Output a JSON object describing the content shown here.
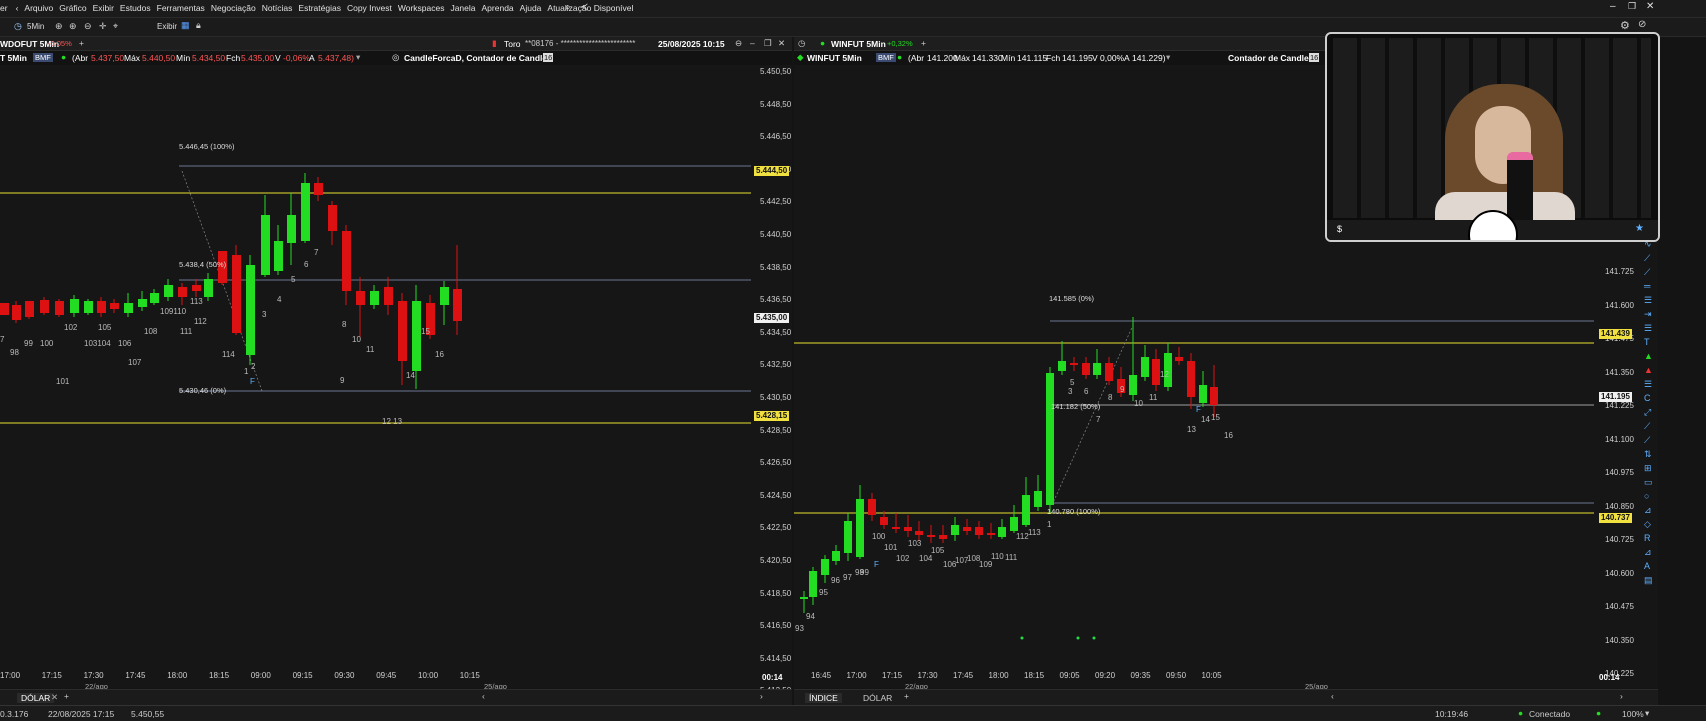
{
  "menu": {
    "items": [
      "er",
      "Arquivo",
      "Gráfico",
      "Exibir",
      "Estudos",
      "Ferramentas",
      "Negociação",
      "Notícias",
      "Estratégias",
      "Copy Invest",
      "Workspaces",
      "Janela",
      "Aprenda",
      "Ajuda",
      "Atualização Disponível"
    ]
  },
  "toolbar": {
    "interval": "5Min",
    "view_label": "Exibir"
  },
  "left_chart": {
    "tab_title": "WDOFUT 5Min",
    "tab_change": "-0,05%",
    "center_title": "Toro",
    "account": "**08176 - ************************",
    "datetime": "25/08/2025 10:15",
    "symbol": "T 5Min",
    "exchange": "BMF",
    "abr_label": "(Abr",
    "abr_val": "5.437,50",
    "max_label": "Máx",
    "max_val": "5.440,50",
    "min_label": "Mín",
    "min_val": "5.434,50",
    "fch_label": "Fch",
    "fch_val": "5.435,00",
    "v_label": "V",
    "v_val": "-0,06%",
    "a_label": "A",
    "a_val": "5.437,48)",
    "study": "CandleForcaD, Contador de Candles",
    "study_count": "16",
    "y_labels": [
      "5.450,50",
      "5.448,50",
      "5.446,50",
      "5.444,50",
      "5.442,50",
      "5.440,50",
      "5.438,50",
      "5.436,50",
      "5.434,50",
      "5.432,50",
      "5.430,50",
      "5.428,50",
      "5.426,50",
      "5.424,50",
      "5.422,50",
      "5.420,50",
      "5.418,50",
      "5.416,50",
      "5.414,50",
      "5.412,50"
    ],
    "tag_yellow1": "5.444,50",
    "tag_white": "5.435,00",
    "tag_yellow2": "5.428,15",
    "fib_top": "5.446,45 (100%)",
    "fib_mid": "5.438,4 (50%)",
    "fib_bot": "5.430,46 (0%)",
    "x_labels": [
      "17:00",
      "17:15",
      "17:30",
      "17:45",
      "18:00",
      "18:15",
      "09:00",
      "09:15",
      "09:30",
      "09:45",
      "10:00",
      "10:15"
    ],
    "date_left": "22/ago",
    "date_right": "25/ago",
    "countdown": "00:14",
    "bottom_tab": "DÓLAR",
    "candle_labels": [
      "7",
      "98",
      "99",
      "100",
      "101",
      "102",
      "103104",
      "105",
      "106",
      "107",
      "108",
      "109110",
      "111",
      "112",
      "113",
      "114",
      "1",
      "2",
      "3",
      "4",
      "5",
      "6",
      "7",
      "8",
      "9",
      "10",
      "11",
      "12 13",
      "14",
      "15",
      "16",
      "F"
    ]
  },
  "right_chart": {
    "tab_title": "WINFUT 5Min",
    "tab_change": "+0,32%",
    "symbol": "WINFUT 5Min",
    "exchange": "BMF",
    "abr_label": "(Abr",
    "abr_val": "141.200",
    "max_label": "Máx",
    "max_val": "141.330",
    "min_label": "Mín",
    "min_val": "141.115",
    "fch_label": "Fch",
    "fch_val": "141.195",
    "v_label": "V",
    "v_val": "0,00%",
    "a_label": "A",
    "a_val": "141.229)",
    "study": "Contador de Candles",
    "study_count": "16",
    "y_labels": [
      "141.725",
      "141.600",
      "141.475",
      "141.350",
      "141.225",
      "141.100",
      "140.975",
      "140.850",
      "140.725",
      "140.600",
      "140.475",
      "140.350",
      "140.225"
    ],
    "tag_yellow1": "141.439",
    "tag_white": "141.195",
    "tag_yellow2": "140.737",
    "fib_top": "141.585 (0%)",
    "fib_mid": "141.182 (50%)",
    "fib_bot": "140.780 (100%)",
    "x_labels": [
      "16:45",
      "17:00",
      "17:15",
      "17:30",
      "17:45",
      "18:00",
      "18:15",
      "09:05",
      "09:20",
      "09:35",
      "09:50",
      "10:05"
    ],
    "date_left": "22/ago",
    "date_right": "25/ago",
    "countdown": "00:14",
    "bottom_tabs": [
      "ÍNDICE",
      "DÓLAR"
    ],
    "candle_labels": [
      "93",
      "94",
      "95",
      "96",
      "97",
      "98",
      "99",
      "100",
      "101",
      "102",
      "103",
      "104",
      "105",
      "106",
      "107",
      "108",
      "109",
      "110",
      "111",
      "112",
      "113",
      "1",
      "3",
      "5",
      "6",
      "7",
      "8",
      "9",
      "10",
      "11",
      "12",
      "13",
      "14",
      "15",
      "16",
      "F",
      "F"
    ]
  },
  "status": {
    "left": "0.3.176",
    "date": "22/08/2025 17:15",
    "price": "5.450,55",
    "time": "10:19:46",
    "conn": "Conectado",
    "zoom": "100%"
  },
  "colors": {
    "up": "#22dd22",
    "down": "#dd1111",
    "yellow": "#e8e030",
    "accent": "#2ea0ff"
  },
  "icons": [
    "back-icon",
    "search-icon",
    "share-icon",
    "gear-icon",
    "minimize-icon",
    "restore-icon",
    "close-icon",
    "lock-icon",
    "star-icon",
    "dollar-icon"
  ]
}
